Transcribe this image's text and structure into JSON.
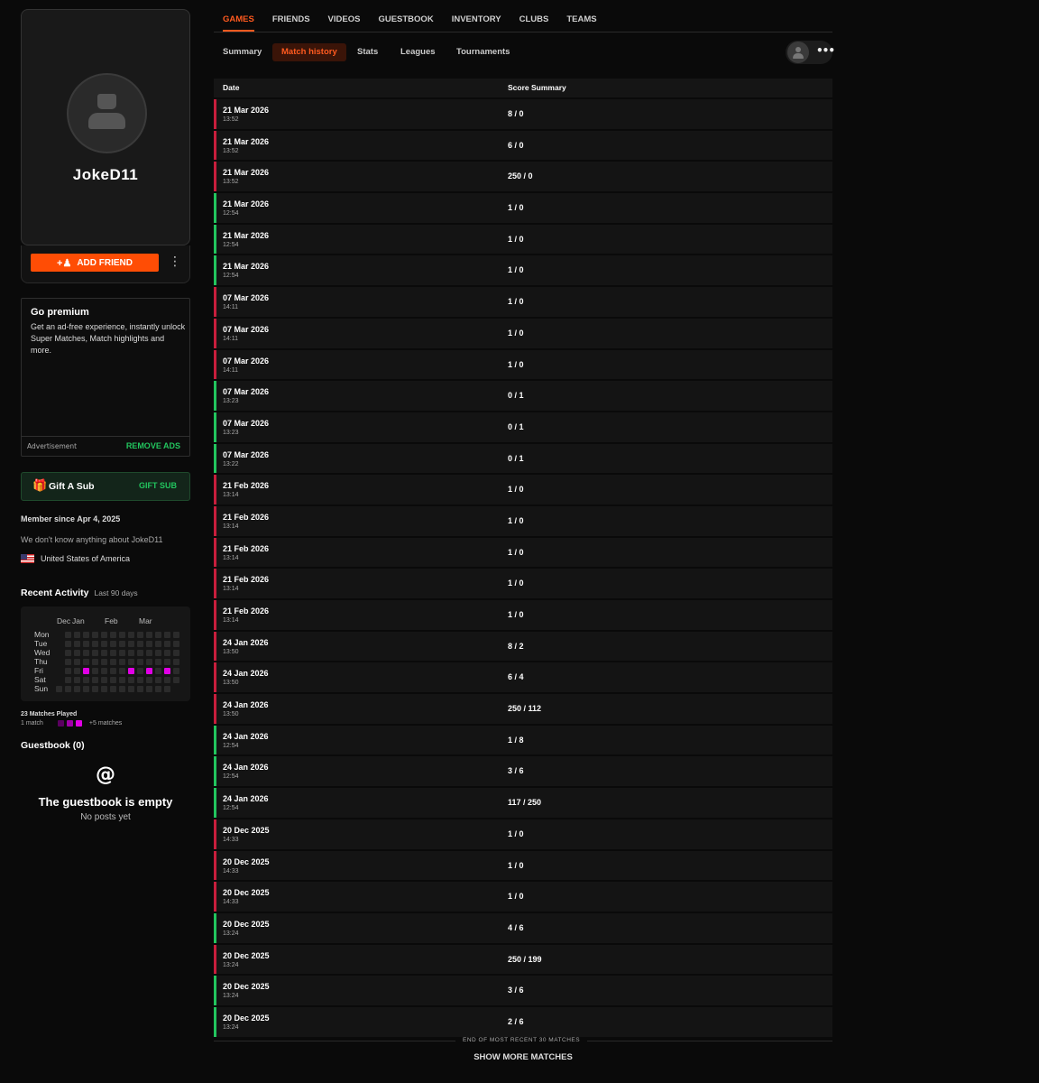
{
  "profile": {
    "username": "JokeD11",
    "add_friend_label": "ADD FRIEND"
  },
  "premium": {
    "title": "Go premium",
    "description": "Get an ad-free experience, instantly unlock Super Matches, Match highlights and more.",
    "ad_label": "Advertisement",
    "remove_ads": "REMOVE ADS"
  },
  "gift": {
    "title": "Gift A Sub",
    "action": "GIFT SUB"
  },
  "about": {
    "member_since": "Member since Apr 4, 2025",
    "bio": "We don't know anything about JokeD11",
    "country": "United States of America"
  },
  "activity": {
    "title": "Recent Activity",
    "subtitle": "Last 90 days",
    "months": [
      "Dec",
      "Jan",
      "Feb",
      "Mar"
    ],
    "days": [
      "Mon",
      "Tue",
      "Wed",
      "Thu",
      "Fri",
      "Sat",
      "Sun"
    ],
    "matches_played": "23 Matches Played",
    "legend_low": "1 match",
    "legend_high": "+5 matches"
  },
  "guestbook": {
    "title": "Guestbook (0)",
    "empty_title": "The guestbook is empty",
    "empty_sub": "No posts yet"
  },
  "nav": {
    "tabs": [
      "GAMES",
      "FRIENDS",
      "VIDEOS",
      "GUESTBOOK",
      "INVENTORY",
      "CLUBS",
      "TEAMS"
    ],
    "active_tab": "GAMES",
    "subtabs": [
      "Summary",
      "Match history",
      "Stats",
      "Leagues",
      "Tournaments"
    ],
    "active_subtab": "Match history"
  },
  "table": {
    "col_date": "Date",
    "col_score": "Score Summary",
    "rows": [
      {
        "date": "21 Mar 2026",
        "time": "13:52",
        "score": "8 / 0",
        "result": "loss"
      },
      {
        "date": "21 Mar 2026",
        "time": "13:52",
        "score": "6 / 0",
        "result": "loss"
      },
      {
        "date": "21 Mar 2026",
        "time": "13:52",
        "score": "250 / 0",
        "result": "loss"
      },
      {
        "date": "21 Mar 2026",
        "time": "12:54",
        "score": "1 / 0",
        "result": "win"
      },
      {
        "date": "21 Mar 2026",
        "time": "12:54",
        "score": "1 / 0",
        "result": "win"
      },
      {
        "date": "21 Mar 2026",
        "time": "12:54",
        "score": "1 / 0",
        "result": "win"
      },
      {
        "date": "07 Mar 2026",
        "time": "14:11",
        "score": "1 / 0",
        "result": "loss"
      },
      {
        "date": "07 Mar 2026",
        "time": "14:11",
        "score": "1 / 0",
        "result": "loss"
      },
      {
        "date": "07 Mar 2026",
        "time": "14:11",
        "score": "1 / 0",
        "result": "loss"
      },
      {
        "date": "07 Mar 2026",
        "time": "13:23",
        "score": "0 / 1",
        "result": "win"
      },
      {
        "date": "07 Mar 2026",
        "time": "13:23",
        "score": "0 / 1",
        "result": "win"
      },
      {
        "date": "07 Mar 2026",
        "time": "13:22",
        "score": "0 / 1",
        "result": "win"
      },
      {
        "date": "21 Feb 2026",
        "time": "13:14",
        "score": "1 / 0",
        "result": "loss"
      },
      {
        "date": "21 Feb 2026",
        "time": "13:14",
        "score": "1 / 0",
        "result": "loss"
      },
      {
        "date": "21 Feb 2026",
        "time": "13:14",
        "score": "1 / 0",
        "result": "loss"
      },
      {
        "date": "21 Feb 2026",
        "time": "13:14",
        "score": "1 / 0",
        "result": "loss"
      },
      {
        "date": "21 Feb 2026",
        "time": "13:14",
        "score": "1 / 0",
        "result": "loss"
      },
      {
        "date": "24 Jan 2026",
        "time": "13:50",
        "score": "8 / 2",
        "result": "loss"
      },
      {
        "date": "24 Jan 2026",
        "time": "13:50",
        "score": "6 / 4",
        "result": "loss"
      },
      {
        "date": "24 Jan 2026",
        "time": "13:50",
        "score": "250 / 112",
        "result": "loss"
      },
      {
        "date": "24 Jan 2026",
        "time": "12:54",
        "score": "1 / 8",
        "result": "win"
      },
      {
        "date": "24 Jan 2026",
        "time": "12:54",
        "score": "3 / 6",
        "result": "win"
      },
      {
        "date": "24 Jan 2026",
        "time": "12:54",
        "score": "117 / 250",
        "result": "win"
      },
      {
        "date": "20 Dec 2025",
        "time": "14:33",
        "score": "1 / 0",
        "result": "loss"
      },
      {
        "date": "20 Dec 2025",
        "time": "14:33",
        "score": "1 / 0",
        "result": "loss"
      },
      {
        "date": "20 Dec 2025",
        "time": "14:33",
        "score": "1 / 0",
        "result": "loss"
      },
      {
        "date": "20 Dec 2025",
        "time": "13:24",
        "score": "4 / 6",
        "result": "win"
      },
      {
        "date": "20 Dec 2025",
        "time": "13:24",
        "score": "250 / 199",
        "result": "loss"
      },
      {
        "date": "20 Dec 2025",
        "time": "13:24",
        "score": "3 / 6",
        "result": "win"
      },
      {
        "date": "20 Dec 2025",
        "time": "13:24",
        "score": "2 / 6",
        "result": "win"
      }
    ],
    "end_text": "END OF MOST RECENT 30 MATCHES",
    "show_more": "SHOW MORE MATCHES"
  },
  "colors": {
    "accent": "#ff5a1f",
    "win": "#22c55e",
    "loss": "#c81e3c",
    "heat_on": "#e100e6"
  }
}
